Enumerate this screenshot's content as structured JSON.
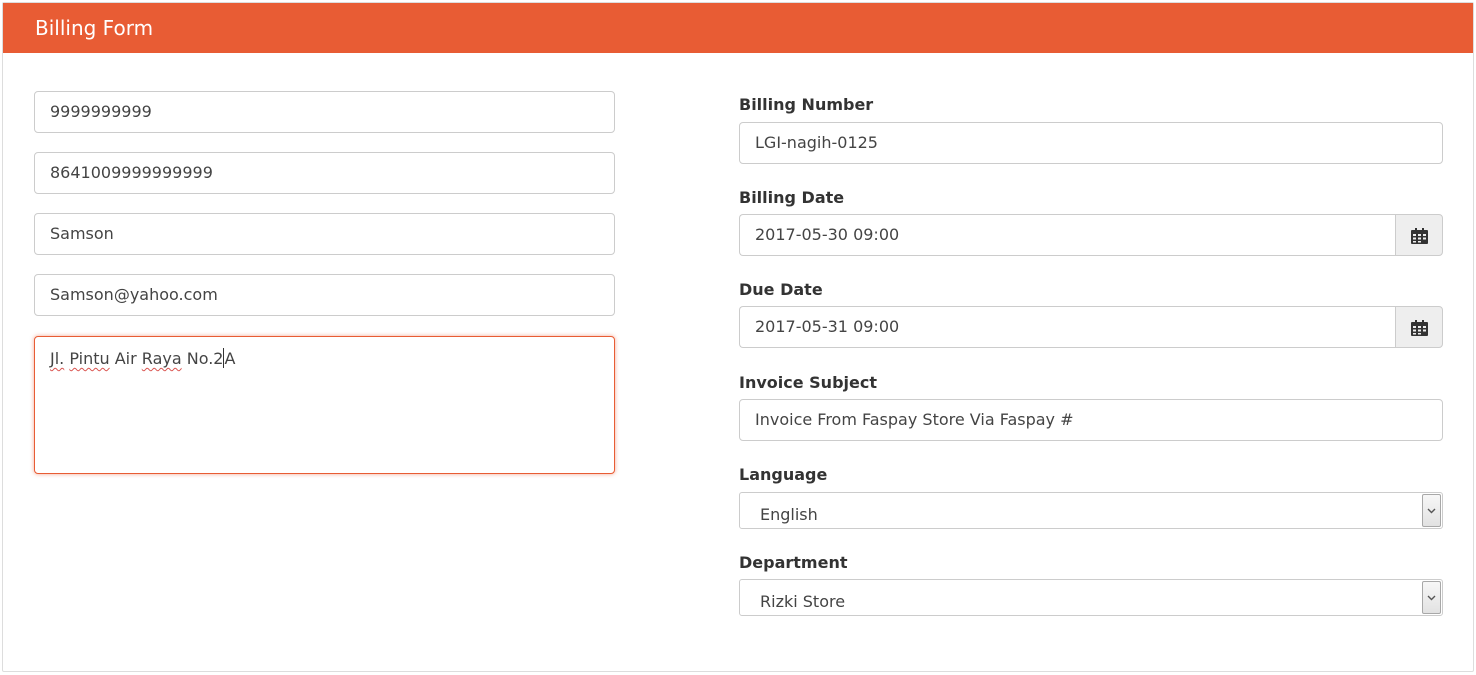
{
  "header": {
    "title": "Billing Form"
  },
  "left_form": {
    "field1_value": "9999999999",
    "field2_value": "8641009999999999",
    "name_value": "Samson",
    "email_value": "Samson@yahoo.com",
    "address": {
      "word1": "Jl.",
      "word2": "Pintu",
      "word3": "Air",
      "word4": "Raya",
      "word5": "No.2",
      "word6": "A"
    }
  },
  "right_form": {
    "billing_number": {
      "label": "Billing Number",
      "value": "LGI-nagih-0125"
    },
    "billing_date": {
      "label": "Billing Date",
      "value": "2017-05-30 09:00"
    },
    "due_date": {
      "label": "Due Date",
      "value": "2017-05-31 09:00"
    },
    "invoice_subject": {
      "label": "Invoice Subject",
      "value": "Invoice From Faspay Store Via Faspay #"
    },
    "language": {
      "label": "Language",
      "selected": "English"
    },
    "department": {
      "label": "Department",
      "selected": "Rizki Store"
    }
  },
  "icons": {
    "date_picker": "calendar-icon",
    "select_arrow": "chevron-down-icon"
  },
  "colors": {
    "header_bg": "#e85c34",
    "focus_border": "#e85c34",
    "spellcheck_underline": "#d9534f"
  }
}
